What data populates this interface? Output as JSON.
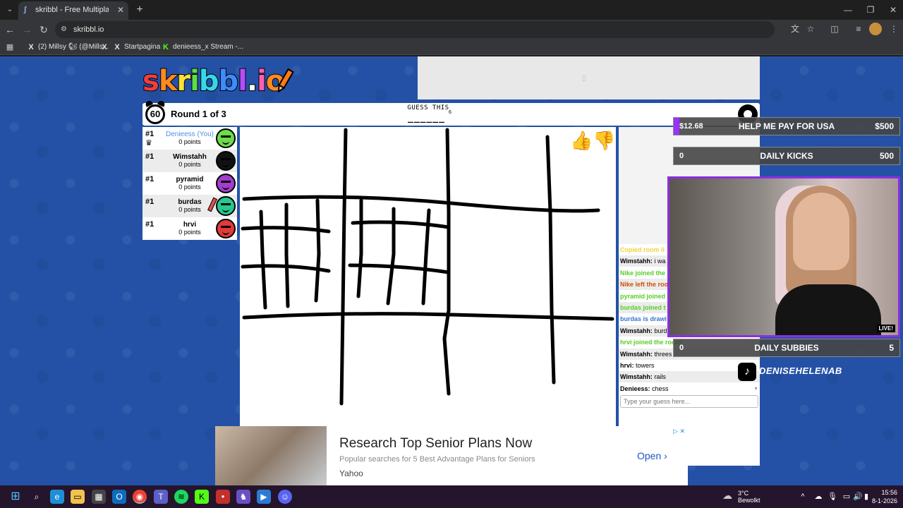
{
  "browser": {
    "tab_title": "skribbl - Free Multiplayer Drawing",
    "address": "skribbl.io",
    "bookmarks": [
      {
        "icon": "X",
        "label": "(2) Millsy 🐿 (@Mills..."
      },
      {
        "icon": "X",
        "label": ""
      },
      {
        "icon": "X",
        "label": "Startpagina"
      },
      {
        "icon": "K",
        "label": "denieess_x Stream -..."
      }
    ]
  },
  "logo": {
    "letters": [
      "s",
      "k",
      "r",
      "i",
      "b",
      "b",
      "l",
      ".",
      "i",
      "o"
    ],
    "colors": [
      "#ef3e3e",
      "#ff8a1f",
      "#ffe135",
      "#5fdc4a",
      "#35d8e8",
      "#3d8bff",
      "#b34dff",
      "#ffffff",
      "#ff5fb3",
      "#ff8a1f"
    ]
  },
  "game": {
    "timer": "60",
    "round_text": "Round 1 of 3",
    "guess_label": "GUESS THIS",
    "word_hint": "______",
    "word_length": "6",
    "players": [
      {
        "rank": "#1",
        "name": "Denieess (You)",
        "points": "0 points",
        "avatar_color": "#6ddb4a",
        "you": true,
        "owner": true
      },
      {
        "rank": "#1",
        "name": "Wimstahh",
        "points": "0 points",
        "avatar_color": "#111111",
        "you": false
      },
      {
        "rank": "#1",
        "name": "pyramid",
        "points": "0 points",
        "avatar_color": "#a23dcc",
        "you": false
      },
      {
        "rank": "#1",
        "name": "burdas",
        "points": "0 points",
        "avatar_color": "#27c78f",
        "you": false,
        "drawing": true
      },
      {
        "rank": "#1",
        "name": "hrvi",
        "points": "0 points",
        "avatar_color": "#e23a3a",
        "you": false
      }
    ]
  },
  "chat": {
    "messages": [
      {
        "text": "Copied room li",
        "color": "#f0d23c"
      },
      {
        "name": "Wimstahh:",
        "text": " i wa",
        "color": "#000000"
      },
      {
        "text": "Nike joined the",
        "color": "#56ce27"
      },
      {
        "text": "Nike left the roo",
        "color": "#ce4f0a"
      },
      {
        "text": "pyramid joined",
        "color": "#56ce27"
      },
      {
        "text": "burdas joined t",
        "color": "#56ce27"
      },
      {
        "text": "burdas is drawi",
        "color": "#3975ce"
      },
      {
        "name": "Wimstahh:",
        "text": " burd",
        "color": "#000000"
      },
      {
        "text": "hrvi joined the room!",
        "color": "#56ce27"
      },
      {
        "name": "Wimstahh:",
        "text": " threes",
        "color": "#000000"
      },
      {
        "name": "hrvi:",
        "text": " towers",
        "color": "#000000"
      },
      {
        "name": "Wimstahh:",
        "text": " rails",
        "color": "#000000"
      },
      {
        "name": "Denieess:",
        "text": " chess",
        "color": "#000000"
      }
    ],
    "input_placeholder": "Type your guess here..."
  },
  "overlay": {
    "goal1": {
      "left": "$12.68",
      "center": "HELP ME PAY FOR USA",
      "right": "$500",
      "progress": 0.025
    },
    "goal2": {
      "left": "0",
      "center": "DAILY KICKS",
      "right": "500",
      "progress": 0
    },
    "goal3": {
      "left": "0",
      "center": "DAILY SUBBIES",
      "right": "5",
      "progress": 0
    },
    "live_badge": "LIVE!",
    "tiktok_handle": "DENISEHELENAB"
  },
  "ad": {
    "headline": "Research Top Senior Plans Now",
    "description": "Popular searches for 5 Best Advantage Plans for Seniors",
    "source": "Yahoo",
    "cta": "Open"
  },
  "taskbar": {
    "weather_temp": "3°C",
    "weather_cond": "Bewolkt",
    "time": "15:56",
    "date": "8-1-2026"
  }
}
